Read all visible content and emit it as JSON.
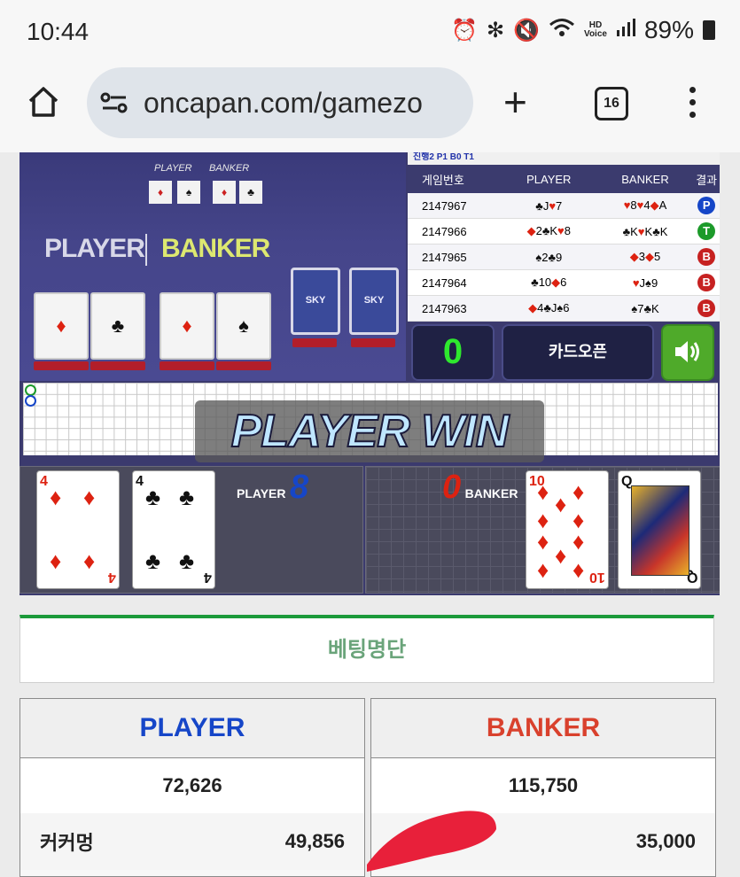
{
  "status_bar": {
    "time": "10:44",
    "hd_label": "HD\nVoice",
    "battery": "89%",
    "icons": [
      "alarm-icon",
      "bluetooth-icon",
      "mute-icon",
      "wifi-icon",
      "signal-icon",
      "battery-icon"
    ]
  },
  "browser": {
    "url": "oncapan.com/gamezo",
    "tab_count": "16"
  },
  "video": {
    "player_label": "PLAYER",
    "banker_label": "BANKER",
    "small_player_label": "PLAYER",
    "small_banker_label": "BANKER",
    "deck_label": "SKY"
  },
  "results": {
    "strip_text": "진행2 P1 B0 T1",
    "headers": [
      "게임번호",
      "PLAYER",
      "BANKER",
      "결과"
    ],
    "rows": [
      {
        "game_no": "2147967",
        "player": "♣J♥7",
        "banker": "♥8♥4◆A",
        "result": "P"
      },
      {
        "game_no": "2147966",
        "player": "◆2♣K♥8",
        "banker": "♣K♥K♣K",
        "result": "T"
      },
      {
        "game_no": "2147965",
        "player": "♠2♣9",
        "banker": "◆3◆5",
        "result": "B"
      },
      {
        "game_no": "2147964",
        "player": "♣10◆6",
        "banker": "♥J♠9",
        "result": "B"
      },
      {
        "game_no": "2147963",
        "player": "◆4♣J♠6",
        "banker": "♠7♣K",
        "result": "B"
      }
    ]
  },
  "controls": {
    "countdown": "0",
    "card_open": "카드오픈"
  },
  "win_banner": "PLAYER WIN",
  "board": {
    "player_label": "PLAYER",
    "player_score": "8",
    "banker_label": "BANKER",
    "banker_score": "0",
    "player_cards": [
      {
        "rank": "4",
        "suit": "♦",
        "color": "#d21"
      },
      {
        "rank": "4",
        "suit": "♣",
        "color": "#111"
      }
    ],
    "banker_cards": [
      {
        "rank": "10",
        "suit": "♦",
        "color": "#d21"
      },
      {
        "rank": "Q",
        "suit": "♠",
        "color": "#111"
      }
    ]
  },
  "betting": {
    "title": "베팅명단",
    "player_header": "PLAYER",
    "banker_header": "BANKER",
    "player_total": "72,626",
    "banker_total": "115,750",
    "player_rows": [
      {
        "name": "커커멍",
        "amount": "49,856"
      }
    ],
    "banker_rows": [
      {
        "name": "",
        "amount": "35,000"
      }
    ]
  },
  "colors": {
    "player": "#1646c8",
    "banker": "#d9412d",
    "tie": "#1c9a2a",
    "accent_green": "#1b9a3a"
  }
}
